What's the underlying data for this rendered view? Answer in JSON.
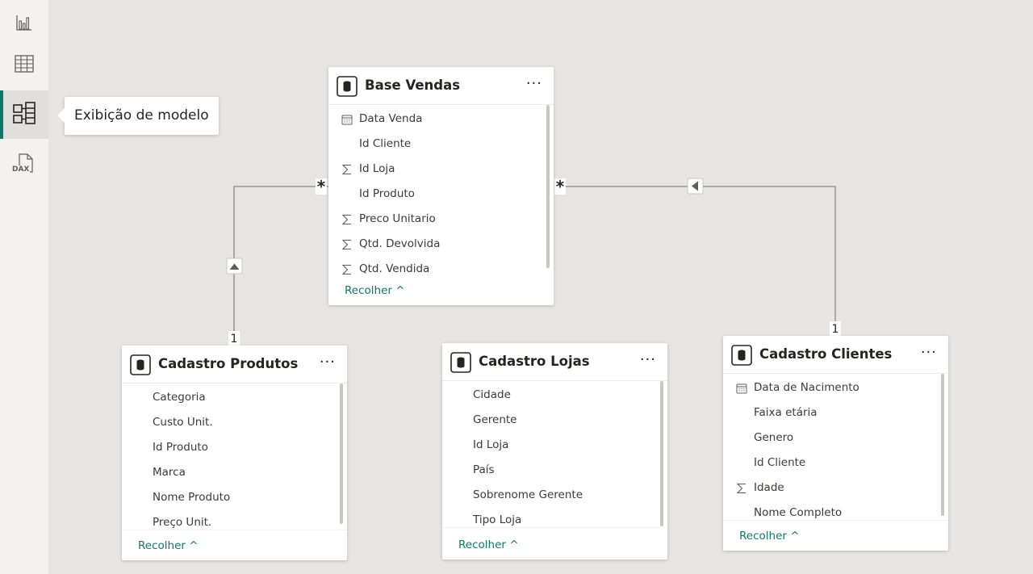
{
  "rail": {
    "items": [
      {
        "name": "report-view",
        "icon": "bar-chart-icon"
      },
      {
        "name": "data-view",
        "icon": "table-grid-icon"
      },
      {
        "name": "model-view",
        "icon": "model-diagram-icon",
        "active": true
      },
      {
        "name": "dax-query-view",
        "icon": "dax-icon"
      }
    ],
    "dax_label": "DAX",
    "tooltip": "Exibição de modelo"
  },
  "accent_color": "#117865",
  "relationships": {
    "many_symbol": "*",
    "one_symbol": "1"
  },
  "tables": {
    "base_vendas": {
      "title": "Base Vendas",
      "more": "···",
      "fields": [
        {
          "label": "Data Venda",
          "icon": "calendar-icon"
        },
        {
          "label": "Id Cliente",
          "icon": ""
        },
        {
          "label": "Id Loja",
          "icon": "sigma-icon"
        },
        {
          "label": "Id Produto",
          "icon": ""
        },
        {
          "label": "Preco Unitario",
          "icon": "sigma-icon"
        },
        {
          "label": "Qtd. Devolvida",
          "icon": "sigma-icon"
        },
        {
          "label": "Qtd. Vendida",
          "icon": "sigma-icon"
        }
      ],
      "collapse": "Recolher"
    },
    "cadastro_produtos": {
      "title": "Cadastro Produtos",
      "more": "···",
      "fields": [
        {
          "label": "Categoria",
          "icon": ""
        },
        {
          "label": "Custo Unit.",
          "icon": ""
        },
        {
          "label": "Id Produto",
          "icon": ""
        },
        {
          "label": "Marca",
          "icon": ""
        },
        {
          "label": "Nome Produto",
          "icon": ""
        },
        {
          "label": "Preço Unit.",
          "icon": ""
        }
      ],
      "collapse": "Recolher"
    },
    "cadastro_lojas": {
      "title": "Cadastro Lojas",
      "more": "···",
      "fields": [
        {
          "label": "Cidade",
          "icon": ""
        },
        {
          "label": "Gerente",
          "icon": ""
        },
        {
          "label": "Id Loja",
          "icon": ""
        },
        {
          "label": "País",
          "icon": ""
        },
        {
          "label": "Sobrenome Gerente",
          "icon": ""
        },
        {
          "label": "Tipo Loja",
          "icon": ""
        }
      ],
      "collapse": "Recolher"
    },
    "cadastro_clientes": {
      "title": "Cadastro Clientes",
      "more": "···",
      "fields": [
        {
          "label": "Data de Nacimento",
          "icon": "calendar-icon"
        },
        {
          "label": "Faixa etária",
          "icon": ""
        },
        {
          "label": "Genero",
          "icon": ""
        },
        {
          "label": "Id Cliente",
          "icon": ""
        },
        {
          "label": "Idade",
          "icon": "sigma-icon"
        },
        {
          "label": "Nome Completo",
          "icon": ""
        }
      ],
      "collapse": "Recolher"
    }
  }
}
